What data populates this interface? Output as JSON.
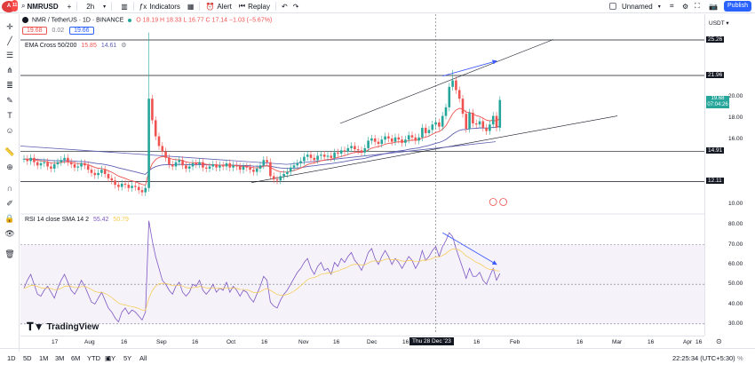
{
  "topbar": {
    "avatar_initial": "A",
    "avatar_badge": "11",
    "symbol": "NMRUSD",
    "interval": "2h",
    "indicators_label": "Indicators",
    "alert_label": "Alert",
    "replay_label": "Replay",
    "layout_name": "Unnamed",
    "publish_label": "Publish"
  },
  "legend": {
    "title": "NMR / TetherUS · 1D · BINANCE",
    "ohlc": "O 18.19 H 18.33 L 16.77 C 17.14 −1.03 (−5.67%)",
    "price_tag_1": "19.68",
    "price_tag_mid": "0.02",
    "price_tag_2": "19.66",
    "ema_label": "EMA Cross 50/200",
    "ema_val1": "15.85",
    "ema_val2": "14.61",
    "rsi_label": "RSI 14 close SMA 14 2",
    "rsi_val1": "55.42",
    "rsi_val2": "50.79"
  },
  "price_axis": {
    "currency": "USDT",
    "ticks": [
      "25.26",
      "21.96",
      "20.00",
      "18.00",
      "16.00",
      "14.91",
      "12.11",
      "10.00"
    ],
    "current_price": "19.68",
    "current_time": "07:04:26",
    "rsi_ticks": [
      "80.00",
      "70.00",
      "60.00",
      "50.00",
      "40.00",
      "30.00"
    ]
  },
  "time_axis": {
    "labels": [
      "17",
      "Aug",
      "16",
      "Sep",
      "16",
      "Oct",
      "16",
      "Nov",
      "16",
      "Dec",
      "16",
      "Jan",
      "16",
      "Feb",
      "16",
      "Mar",
      "16",
      "Apr",
      "16"
    ],
    "crosshair_label": "Thu 28 Dec '23"
  },
  "bottombar": {
    "timeframes": [
      "1D",
      "5D",
      "1M",
      "3M",
      "6M",
      "YTD",
      "1Y",
      "5Y",
      "All"
    ],
    "clock": "22:25:34 (UTC+5:30)",
    "percent_label": "%",
    "log_label": "log",
    "auto_label": "auto"
  },
  "branding": {
    "logo_text": "TradingView"
  },
  "colors": {
    "up": "#26a69a",
    "down": "#ef5350",
    "ema50": "#ef5350",
    "ema200": "#5d5fb2",
    "rsi": "#7e57c2",
    "annotation_arrow": "#3d5afe",
    "accent": "#2962ff"
  },
  "chart_data": {
    "type": "candlestick",
    "symbol": "NMR / TetherUS",
    "interval": "1D",
    "price_range": [
      9.5,
      26
    ],
    "rsi_range": [
      25,
      85
    ],
    "horizontal_levels": [
      25.26,
      21.96,
      14.91,
      12.11
    ],
    "candles_close": [
      14.2,
      14.0,
      14.3,
      13.9,
      13.6,
      13.8,
      13.9,
      13.5,
      13.3,
      13.7,
      13.9,
      14.1,
      14.3,
      13.9,
      13.7,
      13.4,
      13.5,
      13.8,
      13.6,
      13.2,
      12.9,
      12.7,
      12.9,
      13.2,
      12.8,
      12.4,
      12.2,
      11.8,
      11.6,
      11.9,
      11.8,
      11.5,
      11.7,
      11.6,
      11.3,
      11.1,
      11.5,
      19.8,
      17.8,
      16.3,
      15.4,
      14.9,
      14.3,
      13.7,
      13.5,
      13.9,
      14.1,
      13.6,
      13.3,
      13.5,
      13.8,
      13.7,
      13.9,
      13.4,
      13.3,
      13.5,
      13.7,
      13.4,
      13.6,
      13.5,
      13.8,
      13.4,
      13.6,
      13.5,
      13.2,
      13.5,
      13.4,
      13.2,
      13.0,
      13.3,
      13.6,
      14.1,
      13.9,
      12.6,
      12.3,
      12.2,
      12.6,
      12.8,
      13.0,
      13.4,
      13.6,
      13.8,
      14.0,
      14.4,
      14.6,
      14.3,
      14.1,
      14.5,
      14.6,
      14.4,
      14.5,
      14.3,
      14.8,
      14.7,
      15.0,
      14.9,
      15.2,
      15.4,
      15.1,
      15.0,
      14.8,
      15.2,
      15.9,
      16.1,
      15.8,
      15.6,
      16.0,
      16.3,
      16.1,
      15.8,
      16.2,
      16.0,
      15.7,
      16.0,
      16.4,
      16.2,
      15.9,
      16.2,
      17.1,
      16.6,
      16.9,
      17.4,
      17.6,
      17.2,
      18.2,
      19.0,
      20.9,
      21.5,
      20.6,
      19.8,
      18.4,
      17.0,
      18.5,
      17.5,
      17.4,
      17.7,
      17.1,
      16.8,
      17.4,
      18.2,
      17.1,
      19.68
    ],
    "ema_50_50": "15.85",
    "ema_200": "14.61",
    "rsi_values": [
      48,
      52,
      55,
      50,
      45,
      44,
      47,
      49,
      46,
      43,
      48,
      52,
      55,
      51,
      47,
      45,
      48,
      52,
      49,
      45,
      41,
      40,
      43,
      46,
      42,
      38,
      36,
      33,
      31,
      36,
      38,
      35,
      37,
      36,
      34,
      32,
      36,
      82,
      72,
      64,
      58,
      52,
      50,
      47,
      45,
      49,
      51,
      46,
      44,
      46,
      50,
      49,
      52,
      47,
      45,
      47,
      50,
      46,
      48,
      47,
      51,
      46,
      49,
      47,
      44,
      47,
      46,
      43,
      41,
      45,
      49,
      54,
      52,
      41,
      39,
      38,
      42,
      45,
      47,
      50,
      53,
      56,
      58,
      61,
      63,
      58,
      55,
      59,
      61,
      57,
      58,
      55,
      61,
      59,
      63,
      61,
      64,
      66,
      62,
      60,
      57,
      61,
      66,
      68,
      63,
      60,
      64,
      67,
      64,
      60,
      63,
      61,
      58,
      61,
      64,
      62,
      58,
      61,
      67,
      62,
      64,
      67,
      69,
      64,
      69,
      72,
      76,
      74,
      68,
      63,
      58,
      53,
      58,
      54,
      54,
      56,
      52,
      50,
      54,
      58,
      52,
      55.42
    ],
    "annotations": {
      "price_divergence_arrow": {
        "from": 21.9,
        "to": 23.3
      },
      "rsi_divergence_arrow": {
        "from": 76,
        "to": 60
      }
    }
  }
}
